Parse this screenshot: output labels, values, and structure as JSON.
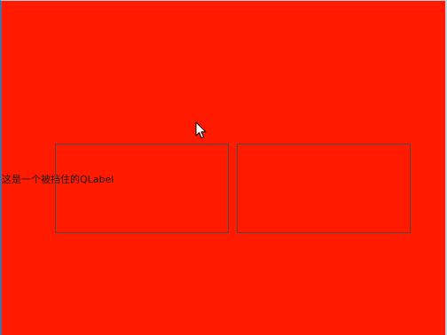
{
  "label": {
    "text": "这是一个被挡住的QLabel"
  },
  "colors": {
    "background": "#ff1a00",
    "frame_border": "#4a4a4a",
    "label_text": "#1a1a1a"
  },
  "icons": {
    "cursor": "mouse-pointer-icon"
  }
}
